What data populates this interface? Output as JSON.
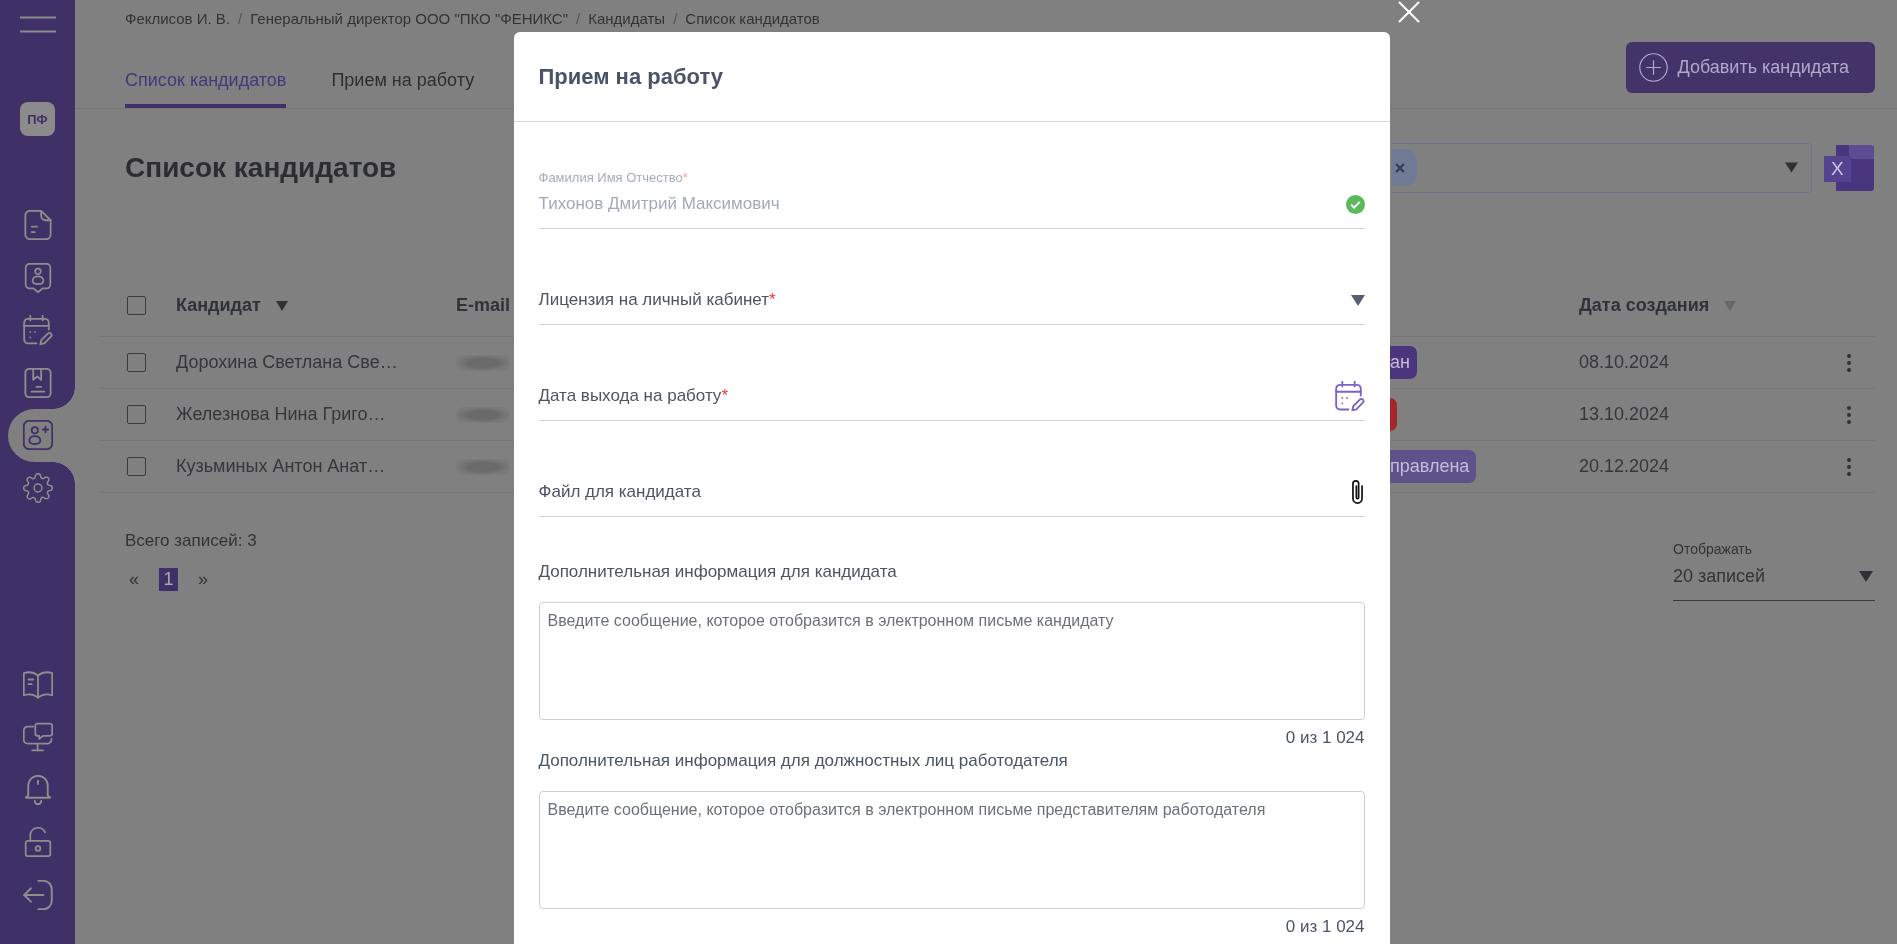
{
  "sidebar": {
    "avatar": "ПФ",
    "nav_items": [
      {
        "selected": false
      },
      {
        "selected": false
      },
      {
        "selected": false
      },
      {
        "selected": false
      },
      {
        "selected": true
      },
      {
        "selected": false
      }
    ],
    "bottom_items": [
      {
        "selected": false
      },
      {
        "selected": false
      },
      {
        "selected": false
      },
      {
        "selected": false
      },
      {
        "selected": false
      }
    ]
  },
  "breadcrumb": [
    {
      "label": "Феклисов И. В."
    },
    {
      "separator": "/",
      "label": "Генеральный директор ООО \"ПКО \"ФЕНИКС\""
    },
    {
      "separator": "/",
      "label": "Кандидаты"
    },
    {
      "separator": "/",
      "label": "Список кандидатов"
    }
  ],
  "tabs": [
    {
      "label": "Список кандидатов",
      "selected": true
    },
    {
      "label": "Прием на работу",
      "selected": false
    }
  ],
  "add_button": {
    "label": "Добавить кандидата"
  },
  "page_title": "Список кандидатов",
  "filter": {
    "chips": [
      {
        "removable": true
      }
    ]
  },
  "export_button": {
    "label": "X"
  },
  "table": {
    "header_checkbox": {
      "checked": false
    },
    "columns": [
      {
        "label": "Кандидат",
        "sort_active": true
      },
      {
        "label": "E-mail"
      },
      {
        "label": "Дата создания",
        "sort_active": false
      }
    ],
    "rows": [
      {
        "checked": false,
        "candidate": "Дорохина Светлана Све…",
        "email_redacted": true,
        "status": {
          "text": "ан",
          "color": "#4b367e"
        },
        "created": "08.10.2024"
      },
      {
        "checked": false,
        "candidate": "Железнова Нина Григо…",
        "email_redacted": true,
        "status": {
          "color": "#a52626"
        },
        "created": "13.10.2024"
      },
      {
        "checked": false,
        "candidate": "Кузьминых Антон Анат…",
        "email_redacted": true,
        "status": {
          "text": "правлена",
          "color": "#5f5189"
        },
        "created": "20.12.2024"
      }
    ]
  },
  "footer": {
    "total": "Всего записей: 3",
    "pagination": {
      "prev": "«",
      "pages": [
        {
          "label": "1",
          "selected": true
        }
      ],
      "next": "»"
    },
    "page_size": {
      "label": "Отображать",
      "value": "20 записей"
    }
  },
  "modal": {
    "title": "Прием на работу",
    "fields": [
      {
        "kind": "text",
        "label": "Фамилия Имя Отчество",
        "required_mark": "*",
        "value": "Тихонов Дмитрий Максимович",
        "disabled": true,
        "valid": true
      },
      {
        "kind": "select",
        "label": "Лицензия на личный кабинет",
        "required_mark": "*"
      },
      {
        "kind": "date",
        "label": "Дата выхода на работу",
        "required_mark": "*"
      },
      {
        "kind": "file",
        "label": "Файл для кандидата"
      }
    ],
    "messages": [
      {
        "label": "Дополнительная информация для кандидата",
        "placeholder": "Введите сообщение, которое отобразится в электронном письме кандидату",
        "counter": "0 из 1 024"
      },
      {
        "label": "Дополнительная информация для должностных лиц работодателя",
        "placeholder": "Введите сообщение, которое отобразится в электронном письме представителям работодателя",
        "counter": "0 из 1 024"
      }
    ]
  }
}
